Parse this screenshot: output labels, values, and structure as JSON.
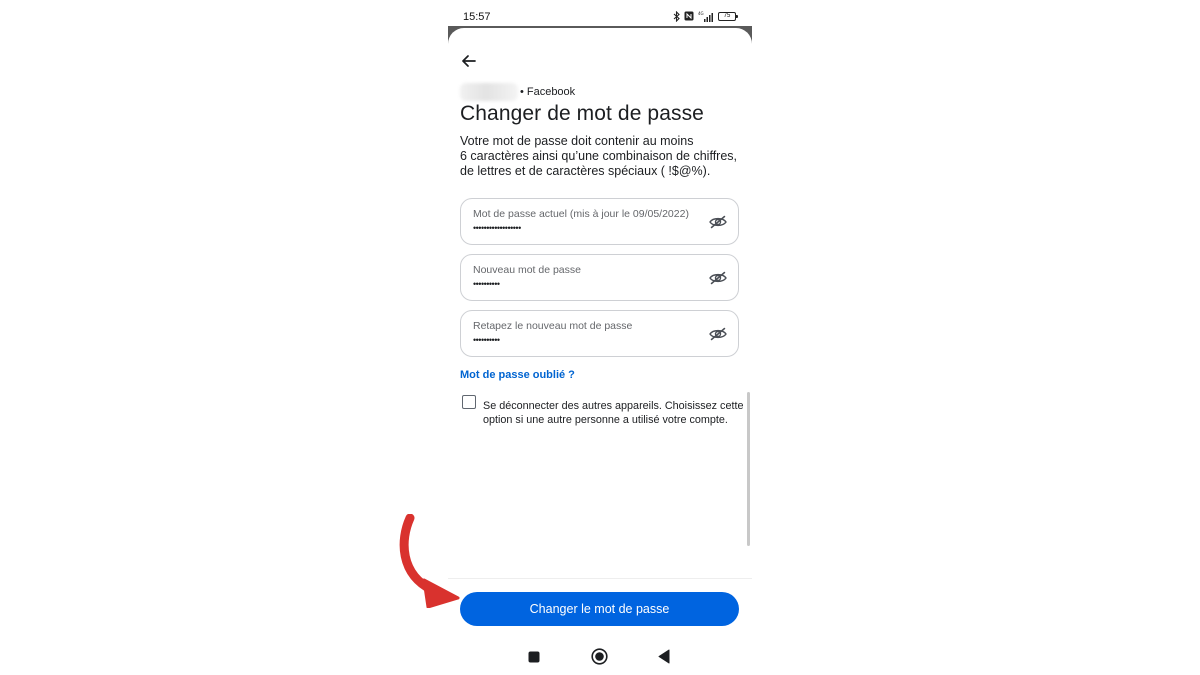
{
  "status_bar": {
    "time": "15:57",
    "battery": "75"
  },
  "header": {
    "account_service": "Facebook",
    "account_separator": "•"
  },
  "page": {
    "title": "Changer de mot de passe",
    "description_lines": [
      "Votre mot de passe doit contenir au moins",
      "6 caractères ainsi qu’une combinaison de chiffres,",
      "de lettres et de caractères spéciaux ( !$@%)."
    ]
  },
  "fields": [
    {
      "label": "Mot de passe actuel (mis à jour le 09/05/2022)",
      "value": "••••••••••••••••••"
    },
    {
      "label": "Nouveau mot de passe",
      "value": "••••••••••"
    },
    {
      "label": "Retapez le nouveau mot de passe",
      "value": "••••••••••"
    }
  ],
  "forgot_link": "Mot de passe oublié ?",
  "logout_option": {
    "checked": false,
    "label_lines": [
      "Se déconnecter des autres appareils. Choisissez cette",
      "option si une autre personne a utilisé votre compte."
    ]
  },
  "primary_button": "Changer le mot de passe",
  "icons": {
    "back": "arrow-left-icon",
    "password_toggle": "eye-off-icon",
    "nav_recents": "square-icon",
    "nav_home": "circle-icon",
    "nav_back": "triangle-back-icon",
    "annotation": "red-curved-arrow"
  },
  "colors": {
    "primary": "#0064e0",
    "link": "#0064d1",
    "annotation_arrow": "#d9322e",
    "field_border": "#ced0d4"
  }
}
